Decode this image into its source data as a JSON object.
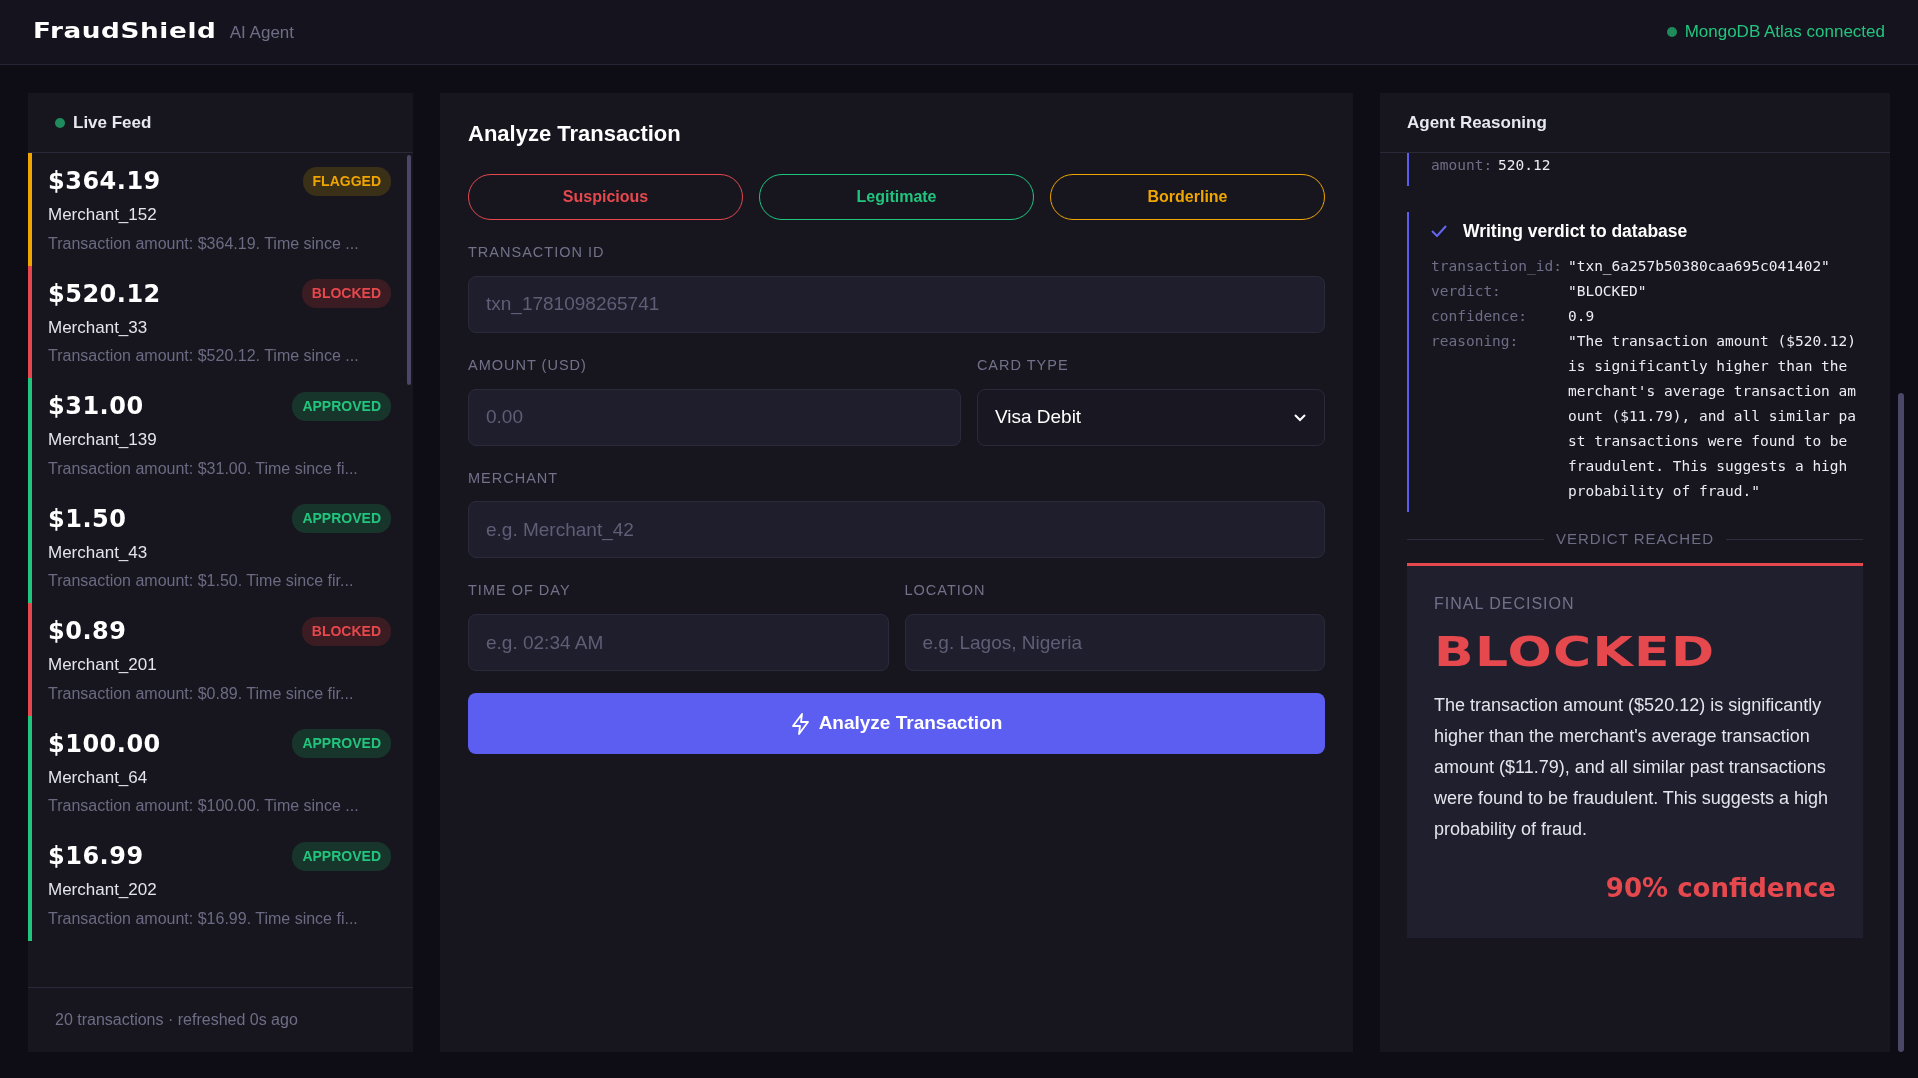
{
  "header": {
    "logo": "FraudShield",
    "subtitle": "AI Agent",
    "connection": "MongoDB Atlas connected"
  },
  "feed": {
    "title": "Live Feed",
    "items": [
      {
        "amount": "$364.19",
        "kind": "flagged",
        "badge": "FLAGGED",
        "merchant": "Merchant_152",
        "summary": "Transaction amount: $364.19. Time since ..."
      },
      {
        "amount": "$520.12",
        "kind": "blocked",
        "badge": "BLOCKED",
        "merchant": "Merchant_33",
        "summary": "Transaction amount: $520.12. Time since ..."
      },
      {
        "amount": "$31.00",
        "kind": "approved",
        "badge": "APPROVED",
        "merchant": "Merchant_139",
        "summary": "Transaction amount: $31.00. Time since fi..."
      },
      {
        "amount": "$1.50",
        "kind": "approved",
        "badge": "APPROVED",
        "merchant": "Merchant_43",
        "summary": "Transaction amount: $1.50. Time since fir..."
      },
      {
        "amount": "$0.89",
        "kind": "blocked",
        "badge": "BLOCKED",
        "merchant": "Merchant_201",
        "summary": "Transaction amount: $0.89. Time since fir..."
      },
      {
        "amount": "$100.00",
        "kind": "approved",
        "badge": "APPROVED",
        "merchant": "Merchant_64",
        "summary": "Transaction amount: $100.00. Time since ..."
      },
      {
        "amount": "$16.99",
        "kind": "approved",
        "badge": "APPROVED",
        "merchant": "Merchant_202",
        "summary": "Transaction amount: $16.99. Time since fi..."
      }
    ],
    "footer": "20 transactions · refreshed 0s ago"
  },
  "form": {
    "title": "Analyze Transaction",
    "presets": [
      {
        "label": "Suspicious",
        "kind": "suspicious"
      },
      {
        "label": "Legitimate",
        "kind": "legitimate"
      },
      {
        "label": "Borderline",
        "kind": "borderline"
      }
    ],
    "rows": [
      [
        {
          "label": "TRANSACTION ID",
          "kind": "input",
          "placeholder": "txn_1781098265741"
        }
      ],
      [
        {
          "label": "AMOUNT (USD)",
          "kind": "input",
          "placeholder": "0.00"
        },
        {
          "label": "CARD TYPE",
          "kind": "select",
          "value": "Visa Debit"
        }
      ],
      [
        {
          "label": "MERCHANT",
          "kind": "input",
          "placeholder": "e.g. Merchant_42"
        }
      ],
      [
        {
          "label": "TIME OF DAY",
          "kind": "input",
          "placeholder": "e.g. 02:34 AM"
        },
        {
          "label": "LOCATION",
          "kind": "input",
          "placeholder": "e.g. Lagos, Nigeria"
        }
      ]
    ],
    "submit": "Analyze Transaction"
  },
  "reasoning": {
    "title": "Agent Reasoning",
    "steps": [
      {
        "fields": [
          {
            "key": "amount:",
            "value": "520.12"
          }
        ]
      },
      {
        "title": "Writing verdict to database",
        "done": true,
        "fields": [
          {
            "key": "transaction_id:",
            "value": "\"txn_6a257b50380caa695c041402\""
          },
          {
            "key": "verdict:",
            "value": "\"BLOCKED\""
          },
          {
            "key": "confidence:",
            "value": "0.9"
          },
          {
            "key": "reasoning:",
            "value": "\"The transaction amount ($520.12) is significantly higher than the merchant's average transaction amount ($11.79), and all similar past transactions were found to be fraudulent. This suggests a high probability of fraud.\""
          }
        ]
      }
    ],
    "divider": "VERDICT REACHED",
    "decision": {
      "label": "FINAL DECISION",
      "kind": "blocked",
      "verdict": "BLOCKED",
      "explanation": "The transaction amount ($520.12) is significantly higher than the merchant's average transaction amount ($11.79), and all similar past transactions were found to be fraudulent. This suggests a high probability of fraud.",
      "confidence": "90% confidence"
    }
  }
}
